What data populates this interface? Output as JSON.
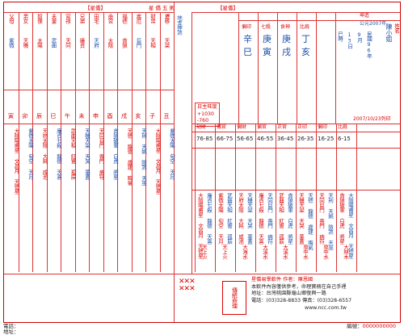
{
  "header": {
    "left_tag": "【星僑】",
    "center_title": "星 僑 五 術",
    "right_tag": "【星僑】"
  },
  "left_columns": [
    "父母 男女 奴僕 夫妻 官祿 兄弟 田宅 命宮 福德",
    "文昌 天鉞 左輔 陀羅 祿存 擎羊 天馬 天魁 右弼 文曲",
    "天府 天同 武曲 太陽 巨門 天相 廉貞 天梁 七殺 破軍",
    "寅 卯 辰 巳 午 未 申 酉 戌 亥 子 丑"
  ],
  "palace_labels": [
    "父母",
    "男女",
    "奴僕",
    "夫妻",
    "官祿",
    "兄弟",
    "田宅",
    "命宮",
    "福德",
    "疾厄",
    "財帛",
    "遷移"
  ],
  "palace_branches": [
    "寅",
    "卯",
    "辰",
    "巳",
    "午",
    "未",
    "申",
    "酉",
    "戌",
    "亥",
    "子",
    "丑"
  ],
  "stars_main": [
    "紫微",
    "天機",
    "太陽",
    "武曲",
    "天同",
    "廉貞",
    "天府",
    "太陰",
    "貪狼",
    "巨門",
    "天相",
    "天梁"
  ],
  "person": {
    "name_label": "姓名",
    "name": "陳小姐",
    "gender": "坤造",
    "calendar": "公元2007年",
    "lunar_year": "民國96年",
    "month": "9月",
    "day": "13日",
    "hour": "巳時",
    "print_date": "2007/10/23列印"
  },
  "pillars": [
    {
      "gan": "丁",
      "zhi": "亥",
      "label": "年"
    },
    {
      "gan": "庚",
      "zhi": "戌",
      "label": "月"
    },
    {
      "gan": "庚",
      "zhi": "寅",
      "label": "日"
    },
    {
      "gan": "辛",
      "zhi": "巳",
      "label": "時"
    }
  ],
  "pillar_notes": [
    "比肩",
    "食神",
    "七殺",
    "偏印",
    "正官",
    "劫財"
  ],
  "center_numbers": {
    "boxed": "日主旺度",
    "value1": "+1030",
    "value2": "-760",
    "side": "地支神煞"
  },
  "age_ranges": [
    "76-85",
    "66-75",
    "56-65",
    "46-55",
    "36-45",
    "26-35",
    "16-25",
    "6-15"
  ],
  "age_headers": [
    "劫財",
    "傷官",
    "偏財",
    "偏官",
    "正官",
    "正印",
    "偏印",
    "比肩"
  ],
  "lower_cells": [
    "大陰陽甫星 文昌月 天德星",
    "紫微太陽 旬空 天月",
    "天府太陰 大耗 咸池",
    "廉貞七殺 龍德 天喜",
    "武曲天相 紅鸞 孤辰",
    "天機天梁 天哭 華蓋",
    "天同巨門 喪門 病符",
    "貪狼破軍 白虎 將星",
    "天德 龍德 歲建 晦氣",
    "天刑 天姚 陰煞 天巫"
  ],
  "bottom_stars": [
    "天上火",
    "天上火",
    "大海水",
    "大溪水",
    "大溪水",
    "泉中水",
    "泉中水",
    "大林木"
  ],
  "seal": {
    "title": "星僑易學軟件",
    "author_label": "作者",
    "author": "陳恩國",
    "line1": "本軟件內容僅供參考，命理實務在自己手裡",
    "line2": "地址：台灣桃園縣龜山鄉復興一路",
    "line3": "電話：(03)328-8833",
    "line4": "傳真：(03)328-6557",
    "url": "www.ncc.com.tw",
    "stamp_text": "傳統命理"
  },
  "footer": {
    "phone_label": "電話：",
    "address_label": "地址：",
    "serial_label": "編號：",
    "serial_value": "0000000000"
  },
  "colors": {
    "ink": "#d00",
    "blue": "#1a4ea8",
    "green": "#0a7a2a",
    "rule": "#d33"
  }
}
